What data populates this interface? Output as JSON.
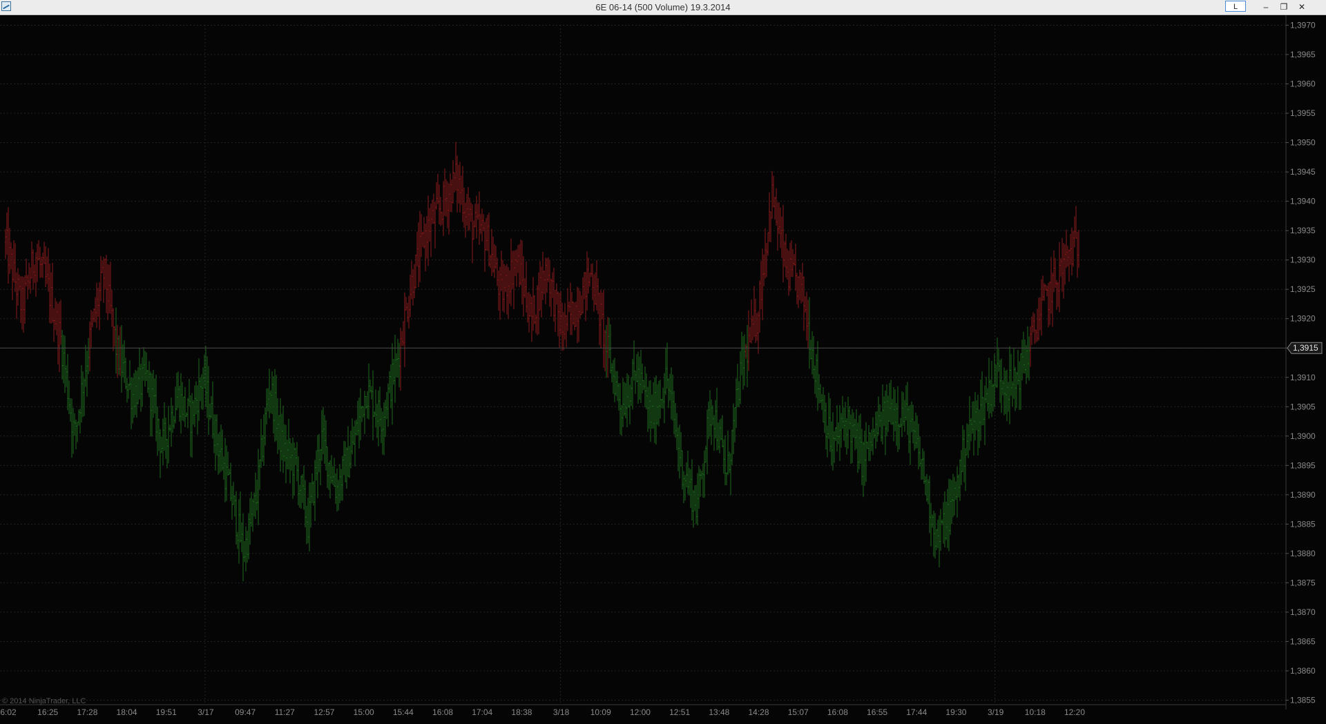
{
  "window": {
    "title": "6E 06-14 (500 Volume)  19.3.2014",
    "link_button": "L",
    "minimize_glyph": "–",
    "restore_glyph": "❐",
    "close_glyph": "✕"
  },
  "chart_data": {
    "type": "bar",
    "title": "6E 06-14 (500 Volume)  19.3.2014",
    "ylim": [
      1.3855,
      1.397
    ],
    "y_ticks": [
      "1,3970",
      "1,3965",
      "1,3960",
      "1,3955",
      "1,3950",
      "1,3945",
      "1,3940",
      "1,3935",
      "1,3930",
      "1,3925",
      "1,3920",
      "1,3915",
      "1,3910",
      "1,3905",
      "1,3900",
      "1,3895",
      "1,3890",
      "1,3885",
      "1,3880",
      "1,3875",
      "1,3870",
      "1,3865",
      "1,3860",
      "1,3855"
    ],
    "y_tick_values": [
      1.397,
      1.3965,
      1.396,
      1.3955,
      1.395,
      1.3945,
      1.394,
      1.3935,
      1.393,
      1.3925,
      1.392,
      1.3915,
      1.391,
      1.3905,
      1.39,
      1.3895,
      1.389,
      1.3885,
      1.388,
      1.3875,
      1.387,
      1.3865,
      1.386,
      1.3855
    ],
    "x_ticks": [
      "6:02",
      "16:25",
      "17:28",
      "18:04",
      "19:51",
      "3/17",
      "09:47",
      "11:27",
      "12:57",
      "15:00",
      "15:44",
      "16:08",
      "17:04",
      "18:38",
      "3/18",
      "10:09",
      "12:00",
      "12:51",
      "13:48",
      "14:28",
      "15:07",
      "16:08",
      "16:55",
      "17:44",
      "19:30",
      "3/19",
      "10:18",
      "12:20"
    ],
    "grid": true,
    "last_price": 1.3915,
    "last_price_label": "1,3915",
    "colors": {
      "down": "#8b1a1a",
      "up": "#1e6b1e",
      "background": "#050505"
    },
    "price_path": [
      [
        0.0,
        1.3933
      ],
      [
        0.015,
        1.3922
      ],
      [
        0.028,
        1.3931
      ],
      [
        0.04,
        1.3925
      ],
      [
        0.052,
        1.3916
      ],
      [
        0.064,
        1.39
      ],
      [
        0.08,
        1.3918
      ],
      [
        0.092,
        1.3928
      ],
      [
        0.104,
        1.3914
      ],
      [
        0.118,
        1.3907
      ],
      [
        0.132,
        1.391
      ],
      [
        0.146,
        1.3898
      ],
      [
        0.16,
        1.3907
      ],
      [
        0.172,
        1.3903
      ],
      [
        0.184,
        1.391
      ],
      [
        0.196,
        1.39
      ],
      [
        0.21,
        1.389
      ],
      [
        0.222,
        1.388
      ],
      [
        0.234,
        1.389
      ],
      [
        0.246,
        1.3909
      ],
      [
        0.258,
        1.3898
      ],
      [
        0.27,
        1.3895
      ],
      [
        0.282,
        1.3885
      ],
      [
        0.294,
        1.39
      ],
      [
        0.308,
        1.3891
      ],
      [
        0.322,
        1.3897
      ],
      [
        0.336,
        1.3908
      ],
      [
        0.35,
        1.3903
      ],
      [
        0.364,
        1.3912
      ],
      [
        0.378,
        1.3926
      ],
      [
        0.392,
        1.3935
      ],
      [
        0.406,
        1.3939
      ],
      [
        0.42,
        1.3944
      ],
      [
        0.434,
        1.3936
      ],
      [
        0.448,
        1.3934
      ],
      [
        0.462,
        1.3924
      ],
      [
        0.476,
        1.393
      ],
      [
        0.49,
        1.392
      ],
      [
        0.504,
        1.3929
      ],
      [
        0.518,
        1.3918
      ],
      [
        0.532,
        1.3922
      ],
      [
        0.546,
        1.3928
      ],
      [
        0.56,
        1.3915
      ],
      [
        0.574,
        1.3905
      ],
      [
        0.588,
        1.3911
      ],
      [
        0.602,
        1.3903
      ],
      [
        0.616,
        1.391
      ],
      [
        0.63,
        1.3895
      ],
      [
        0.644,
        1.3888
      ],
      [
        0.658,
        1.3906
      ],
      [
        0.672,
        1.3893
      ],
      [
        0.686,
        1.3912
      ],
      [
        0.7,
        1.392
      ],
      [
        0.714,
        1.3941
      ],
      [
        0.728,
        1.3928
      ],
      [
        0.742,
        1.3925
      ],
      [
        0.756,
        1.391
      ],
      [
        0.77,
        1.3898
      ],
      [
        0.784,
        1.3903
      ],
      [
        0.798,
        1.3896
      ],
      [
        0.812,
        1.3901
      ],
      [
        0.826,
        1.3905
      ],
      [
        0.84,
        1.3903
      ],
      [
        0.854,
        1.3895
      ],
      [
        0.868,
        1.3882
      ],
      [
        0.882,
        1.3888
      ],
      [
        0.896,
        1.39
      ],
      [
        0.91,
        1.3905
      ],
      [
        0.924,
        1.3911
      ],
      [
        0.938,
        1.3908
      ],
      [
        0.952,
        1.3914
      ],
      [
        0.966,
        1.3922
      ],
      [
        0.98,
        1.3927
      ],
      [
        0.994,
        1.3932
      ]
    ]
  },
  "copyright": "© 2014 NinjaTrader, LLC"
}
